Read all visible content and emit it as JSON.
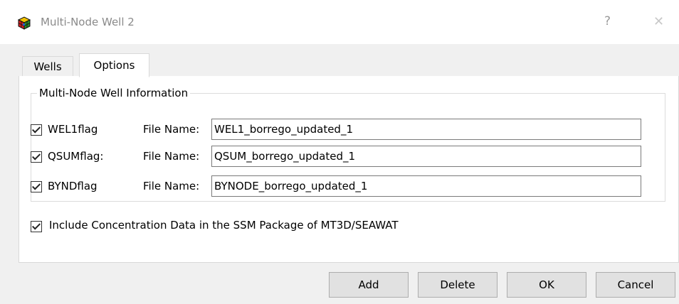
{
  "window": {
    "title": "Multi-Node Well 2",
    "help_glyph": "?",
    "close_glyph": "✕",
    "icon": "app-cube-icon"
  },
  "tabs": [
    {
      "label": "Wells",
      "selected": false
    },
    {
      "label": "Options",
      "selected": true
    }
  ],
  "group": {
    "legend": "Multi-Node Well Information",
    "file_name_label": "File Name:",
    "rows": [
      {
        "flag": "WEL1flag",
        "checked": true,
        "file_name": "WEL1_borrego_updated_1"
      },
      {
        "flag": "QSUMflag:",
        "checked": true,
        "file_name": "QSUM_borrego_updated_1"
      },
      {
        "flag": "BYNDflag",
        "checked": true,
        "file_name": "BYNODE_borrego_updated_1"
      }
    ]
  },
  "include_concentration": {
    "label": "Include Concentration Data in the SSM Package of MT3D/SEAWAT",
    "checked": true
  },
  "buttons": {
    "add": "Add",
    "delete": "Delete",
    "ok": "OK",
    "cancel": "Cancel"
  }
}
